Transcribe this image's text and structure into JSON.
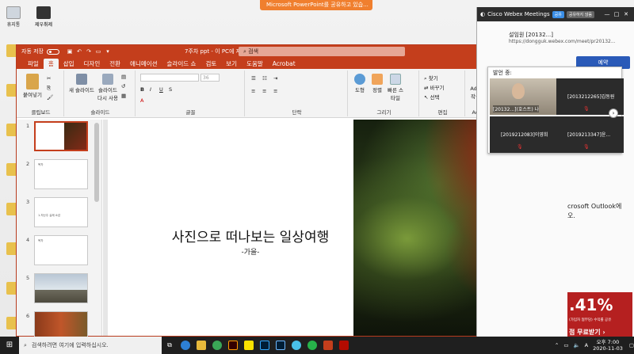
{
  "banner": {
    "text": "Microsoft PowerPoint를 공유하고 있습..."
  },
  "desktop": {
    "icons": [
      {
        "label": "휴지통"
      },
      {
        "label": "제우취제"
      }
    ]
  },
  "ppt": {
    "autosave_label": "자동 저장",
    "filename": "7주차 ppt - 이 PC에 저장됨",
    "search_label": "검색",
    "user_label": "설",
    "tabs": [
      "파일",
      "홈",
      "삽입",
      "디자인",
      "전환",
      "애니메이션",
      "슬라이드 쇼",
      "검토",
      "보기",
      "도움말",
      "Acrobat"
    ],
    "active_tab": "홈",
    "ribbon": {
      "paste": "붙여넣기",
      "clipboard": "클립보드",
      "new_slide": "새 슬라이드",
      "reuse_slide": "슬라이드 다시 사용",
      "slides": "슬라이드",
      "font": "글꼴",
      "font_size": "36",
      "paragraph": "단락",
      "shapes": "도형",
      "arrange": "정렬",
      "quick_styles": "빠른 스타일",
      "drawing": "그리기",
      "find": "찾기",
      "replace": "바꾸기",
      "select": "선택",
      "editing": "편집",
      "acrobat_pdf": "Adobe PDF 작성 및 공유",
      "acrobat_group": "Adobe Acro"
    },
    "thumbnails": [
      {
        "num": "1",
        "text": ""
      },
      {
        "num": "2",
        "text": "목차"
      },
      {
        "num": "3",
        "text": "1.지난주 실제 소감"
      },
      {
        "num": "4",
        "text": "목차"
      },
      {
        "num": "5",
        "text": ""
      },
      {
        "num": "6",
        "text": ""
      }
    ],
    "slide": {
      "title": "사진으로 떠나보는 일상여행",
      "subtitle": "-가을-"
    }
  },
  "webex": {
    "title": "Cisco Webex Meetings",
    "pill1": "공유",
    "pill2": "공유하지 않음",
    "meeting_name": "설임원 [20132...]",
    "meeting_url": "https://dongguk.webex.com/meet/pr20132...",
    "reserve": "예약",
    "outlook_line1": "crosoft Outlook에",
    "outlook_line2": "오.",
    "ad_big": ".41%",
    "ad_small": "(가입자 협부당) 수익률 공유",
    "ad_download": "점 무료받기 ›"
  },
  "speakers": {
    "header": "발언 중:",
    "tiles": [
      {
        "name": "[20132...](호스트) 나"
      },
      {
        "name": "[2013212265]김동원"
      },
      {
        "name": "[2019212083]이영희"
      },
      {
        "name": "[2019213347]윤..."
      }
    ]
  },
  "taskbar": {
    "search_placeholder": "검색하려면 여기에 입력하십시오.",
    "time": "오후 7:00",
    "date": "2020-11-03",
    "lang": "A"
  }
}
